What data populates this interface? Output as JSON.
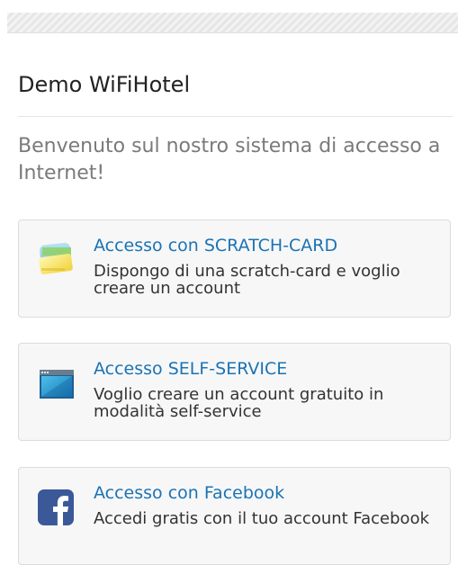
{
  "header": {
    "title": "Demo WiFiHotel"
  },
  "welcome_text": "Benvenuto sul nostro sistema di accesso a Internet!",
  "options": [
    {
      "title": "Accesso con SCRATCH-CARD",
      "description": "Dispongo di una scratch-card e voglio creare un account",
      "icon": "scratch-card-icon"
    },
    {
      "title": "Accesso SELF-SERVICE",
      "description": "Voglio creare un account gratuito in modalità self-service",
      "icon": "self-service-icon"
    },
    {
      "title": "Accesso con Facebook",
      "description": "Accedi gratis con il tuo account Facebook",
      "icon": "facebook-icon"
    }
  ],
  "colors": {
    "link": "#1a73b5",
    "facebook": "#3b5998",
    "card_background": "#f7f7f7"
  }
}
